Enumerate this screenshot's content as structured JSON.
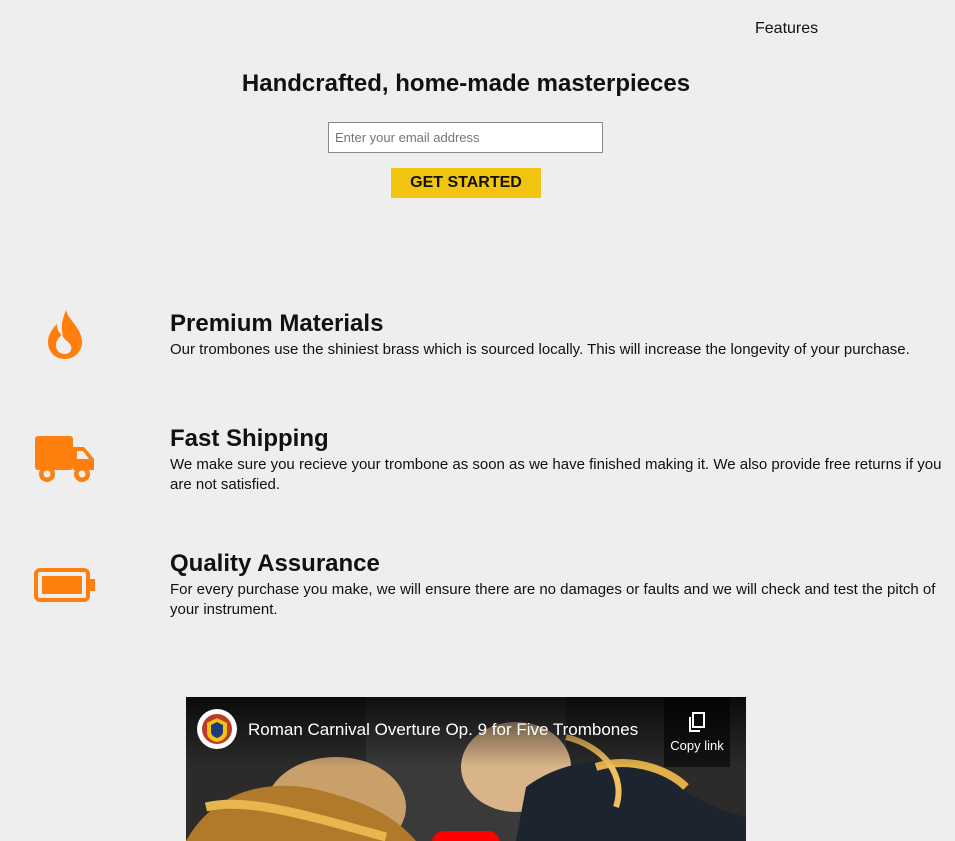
{
  "nav": {
    "features_label": "Features"
  },
  "hero": {
    "title": "Handcrafted, home-made masterpieces",
    "email_placeholder": "Enter your email address",
    "cta_label": "GET STARTED"
  },
  "features": [
    {
      "icon": "fire-icon",
      "title": "Premium Materials",
      "description": "Our trombones use the shiniest brass which is sourced locally. This will increase the longevity of your purchase."
    },
    {
      "icon": "truck-icon",
      "title": "Fast Shipping",
      "description": "We make sure you recieve your trombone as soon as we have finished making it. We also provide free returns if you are not satisfied."
    },
    {
      "icon": "battery-full-icon",
      "title": "Quality Assurance",
      "description": "For every purchase you make, we will ensure there are no damages or faults and we will check and test the pitch of your instrument."
    }
  ],
  "video": {
    "title": "Roman Carnival Overture Op. 9 for Five Trombones",
    "copy_link_label": "Copy link"
  },
  "colors": {
    "accent": "#f1c40f",
    "icon": "#ff7f0e",
    "background": "#eeeeee"
  }
}
